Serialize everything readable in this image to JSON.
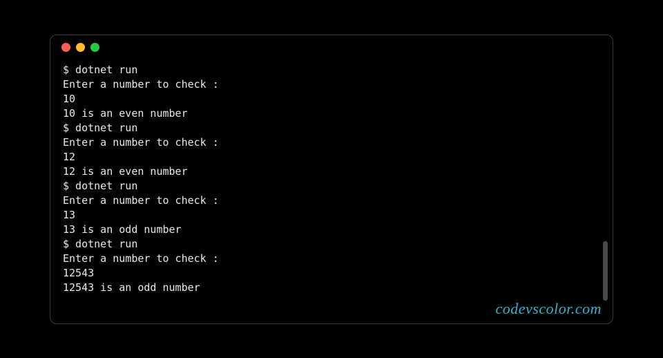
{
  "terminal": {
    "lines": [
      "$ dotnet run",
      "Enter a number to check :",
      "10",
      "10 is an even number",
      "$ dotnet run",
      "Enter a number to check :",
      "12",
      "12 is an even number",
      "$ dotnet run",
      "Enter a number to check :",
      "13",
      "13 is an odd number",
      "$ dotnet run",
      "Enter a number to check :",
      "12543",
      "12543 is an odd number"
    ]
  },
  "watermark": "codevscolor.com"
}
